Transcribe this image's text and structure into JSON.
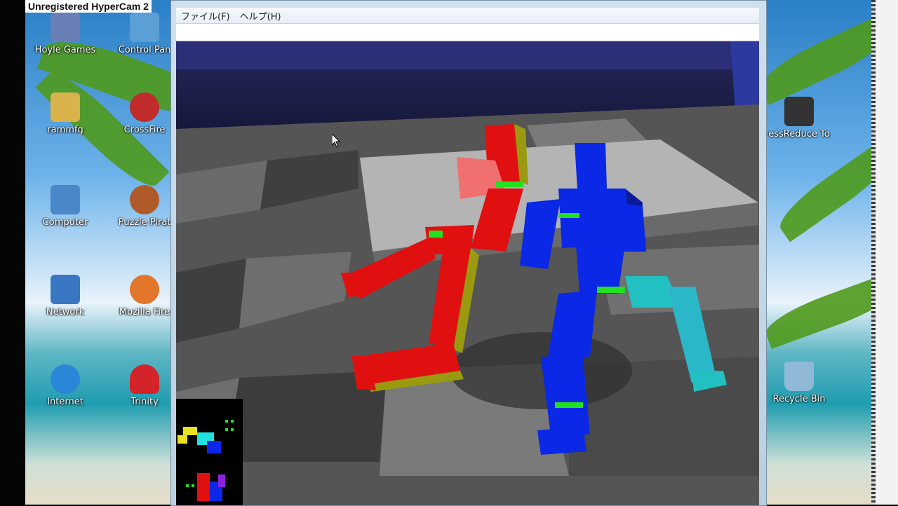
{
  "recorder": {
    "watermark": "Unregistered HyperCam 2"
  },
  "desktop": {
    "left_icons": [
      {
        "label": "Hoyle Games",
        "icon": "folder-games-icon",
        "color": "#6a7fb5"
      },
      {
        "label": "Control Pan",
        "icon": "control-panel-icon",
        "color": "#5a9fd6"
      },
      {
        "label": "rammfg",
        "icon": "folder-icon",
        "color": "#d9b24a"
      },
      {
        "label": "CrossFire",
        "icon": "crossfire-icon",
        "color": "#c02b2b"
      },
      {
        "label": "Computer",
        "icon": "computer-icon",
        "color": "#4a87c9"
      },
      {
        "label": "Puzzle Pirat",
        "icon": "puzzle-pirates-icon",
        "color": "#b05a2a"
      },
      {
        "label": "Network",
        "icon": "network-icon",
        "color": "#3a77c2"
      },
      {
        "label": "Mozilla Fire",
        "icon": "firefox-icon",
        "color": "#e2762a"
      },
      {
        "label": "Internet",
        "icon": "internet-explorer-icon",
        "color": "#2a86d6"
      },
      {
        "label": "Trinity",
        "icon": "trinity-icon",
        "color": "#d4242a"
      }
    ],
    "right_icons": [
      {
        "label": "essReduce To",
        "icon": "app-shortcut-icon",
        "color": "#333333"
      },
      {
        "label": "Recycle Bin",
        "icon": "recycle-bin-icon",
        "color": "#8fb9d6"
      }
    ]
  },
  "window": {
    "menu": [
      {
        "label": "ファイル(F)"
      },
      {
        "label": "ヘルプ(H)"
      }
    ]
  },
  "colors": {
    "fighter_red": "#e01010",
    "fighter_red_shade": "#9a9a10",
    "fighter_blue": "#0a28e6",
    "fighter_blue_shade": "#0a1a9a",
    "joint_green": "#22e022",
    "floor_light": "#6a6a6a",
    "floor_dark": "#4a4a4a"
  }
}
